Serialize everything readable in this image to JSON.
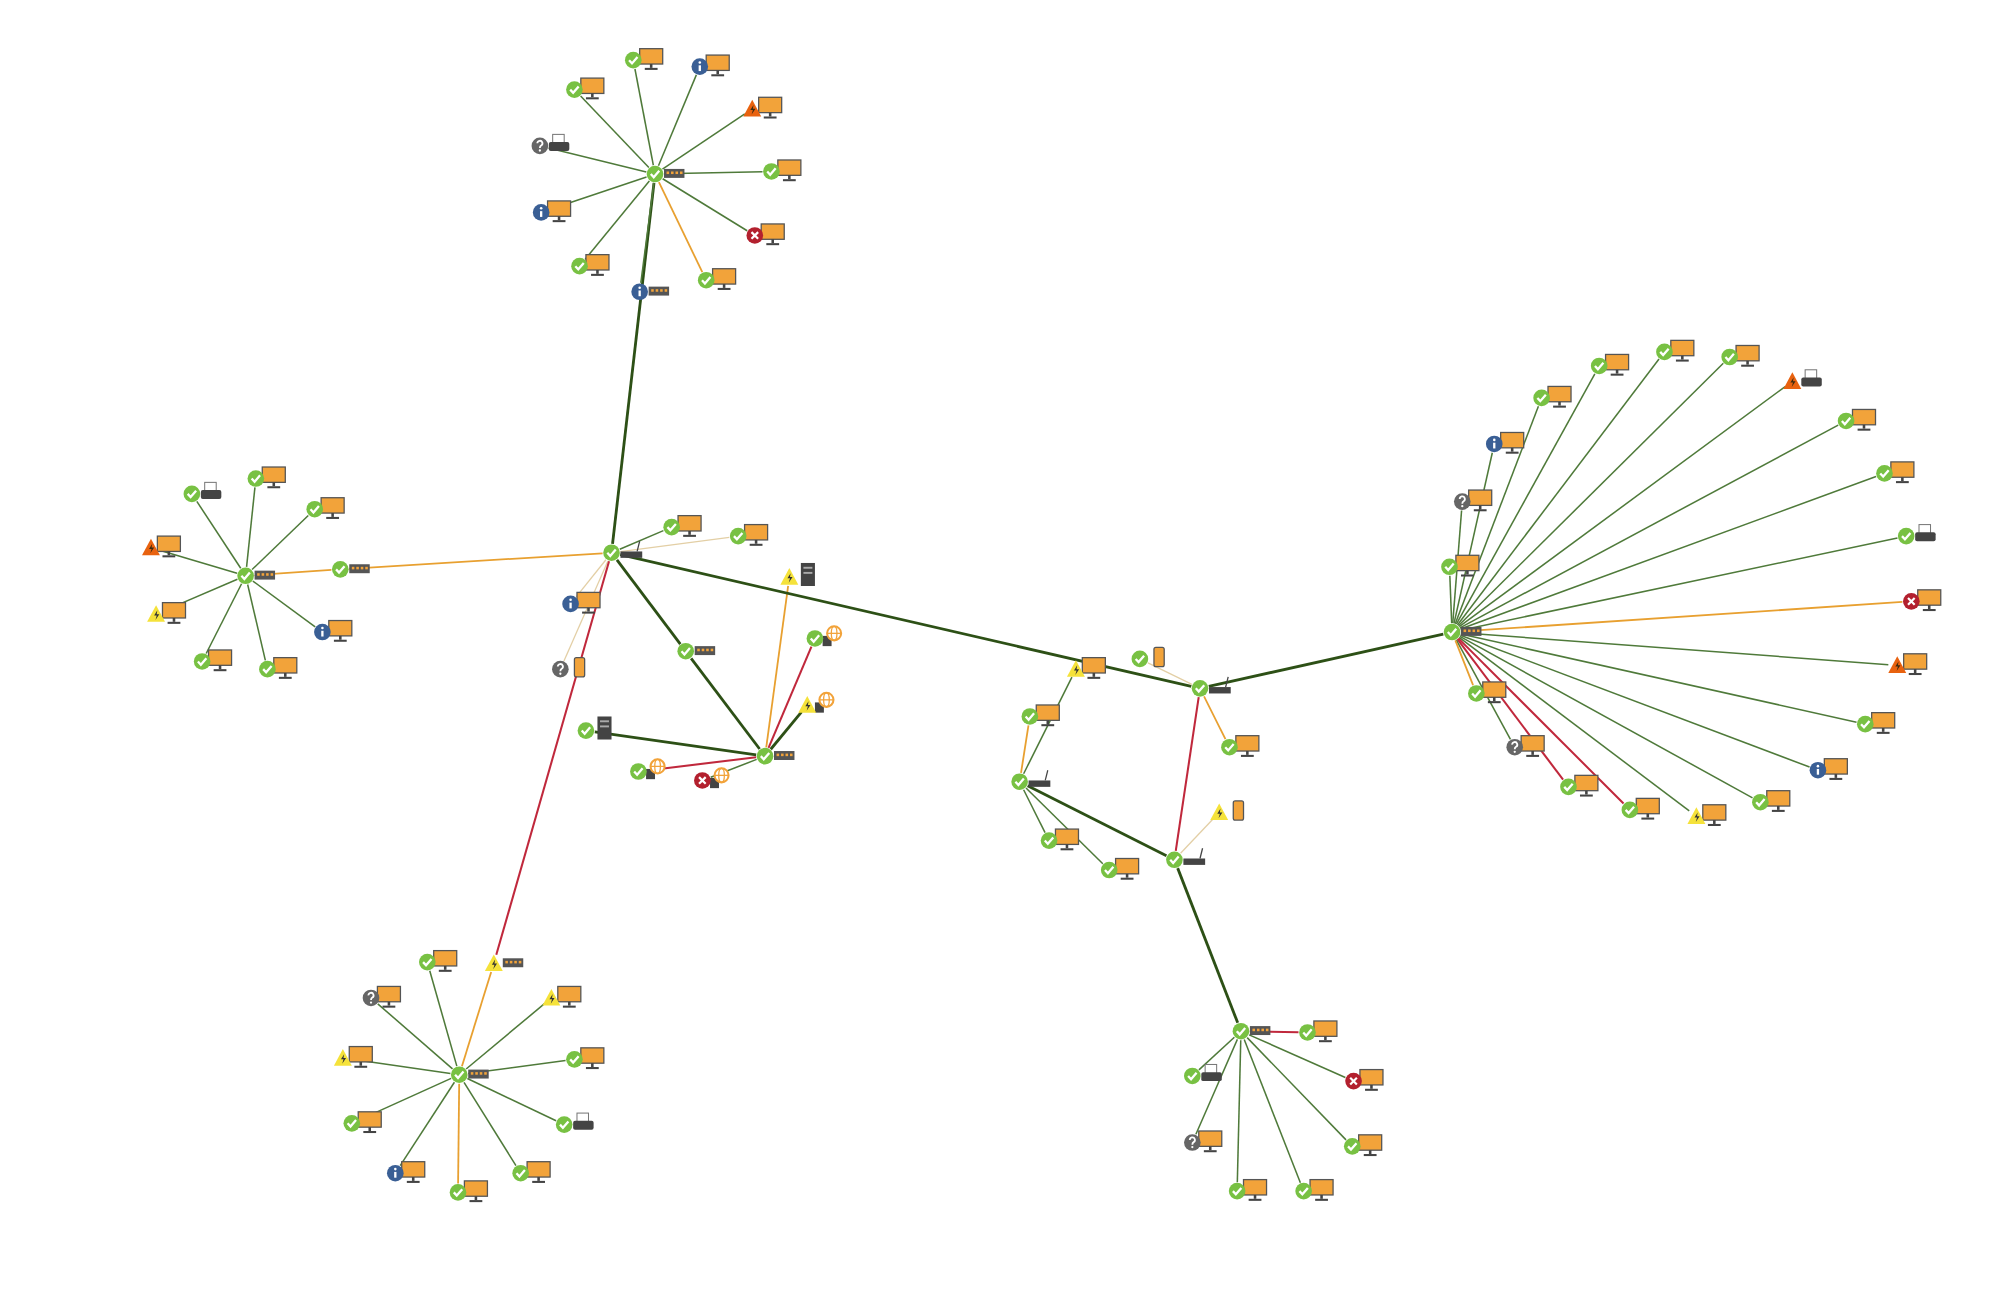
{
  "topology": {
    "kind": "router",
    "badge": {
      "kind": "ok"
    },
    "children": [
      {
        "kind": "switch",
        "badge": {
          "kind": "ok"
        },
        "link": {
          "kind": "strong"
        },
        "children": [
          {
            "kind": "monitor",
            "badge": {
              "kind": "ok"
            },
            "link": {
              "kind": "ok"
            }
          },
          {
            "kind": "monitor",
            "badge": {
              "kind": "info"
            },
            "link": {
              "kind": "ok"
            }
          },
          {
            "kind": "monitor",
            "badge": {
              "kind": "warning"
            },
            "link": {
              "kind": "ok"
            }
          },
          {
            "kind": "monitor",
            "badge": {
              "kind": "ok"
            },
            "link": {
              "kind": "ok"
            }
          },
          {
            "kind": "monitor",
            "badge": {
              "kind": "error"
            },
            "link": {
              "kind": "ok"
            }
          },
          {
            "kind": "monitor",
            "badge": {
              "kind": "ok"
            },
            "link": {
              "kind": "warning"
            }
          },
          {
            "kind": "switch",
            "badge": {
              "kind": "info"
            },
            "link": {
              "kind": "ok"
            }
          },
          {
            "kind": "monitor",
            "badge": {
              "kind": "ok"
            },
            "link": {
              "kind": "ok"
            }
          },
          {
            "kind": "monitor",
            "badge": {
              "kind": "info"
            },
            "link": {
              "kind": "ok"
            }
          },
          {
            "kind": "printer",
            "badge": {
              "kind": "unknown"
            },
            "link": {
              "kind": "ok"
            }
          },
          {
            "kind": "monitor",
            "badge": {
              "kind": "ok"
            },
            "link": {
              "kind": "ok"
            }
          }
        ]
      },
      {
        "kind": "monitor",
        "badge": {
          "kind": "ok"
        },
        "link": {
          "kind": "ok"
        }
      },
      {
        "kind": "monitor",
        "badge": {
          "kind": "ok"
        },
        "link": {
          "kind": "weak"
        }
      },
      {
        "kind": "monitor",
        "badge": {
          "kind": "info"
        },
        "link": {
          "kind": "weak"
        }
      },
      {
        "kind": "phone",
        "badge": {
          "kind": "unknown"
        },
        "link": {
          "kind": "weak"
        }
      },
      {
        "kind": "switch",
        "badge": {
          "kind": "ok"
        },
        "link": {
          "kind": "warning"
        },
        "children": [
          {
            "kind": "switch",
            "badge": {
              "kind": "ok"
            },
            "link": {
              "kind": "warning"
            },
            "children": [
              {
                "kind": "printer",
                "badge": {
                  "kind": "ok"
                },
                "link": {
                  "kind": "ok"
                }
              },
              {
                "kind": "monitor",
                "badge": {
                  "kind": "ok"
                },
                "link": {
                  "kind": "ok"
                }
              },
              {
                "kind": "monitor",
                "badge": {
                  "kind": "ok"
                },
                "link": {
                  "kind": "ok"
                }
              },
              {
                "kind": "monitor",
                "badge": {
                  "kind": "warning"
                },
                "link": {
                  "kind": "ok"
                }
              },
              {
                "kind": "monitor",
                "badge": {
                  "kind": "power"
                },
                "link": {
                  "kind": "ok"
                }
              },
              {
                "kind": "monitor",
                "badge": {
                  "kind": "ok"
                },
                "link": {
                  "kind": "ok"
                }
              },
              {
                "kind": "monitor",
                "badge": {
                  "kind": "ok"
                },
                "link": {
                  "kind": "ok"
                }
              },
              {
                "kind": "monitor",
                "badge": {
                  "kind": "info"
                },
                "link": {
                  "kind": "ok"
                }
              }
            ]
          }
        ]
      },
      {
        "kind": "switch",
        "badge": {
          "kind": "ok"
        },
        "link": {
          "kind": "strong"
        },
        "children": [
          {
            "kind": "switch",
            "badge": {
              "kind": "ok"
            },
            "link": {
              "kind": "strong"
            },
            "children": [
              {
                "kind": "server",
                "badge": {
                  "kind": "power"
                },
                "link": {
                  "kind": "warning"
                }
              },
              {
                "kind": "globe",
                "badge": {
                  "kind": "ok"
                },
                "link": {
                  "kind": "critical"
                }
              },
              {
                "kind": "globe",
                "badge": {
                  "kind": "power"
                },
                "link": {
                  "kind": "strong"
                }
              },
              {
                "kind": "server",
                "badge": {
                  "kind": "ok"
                },
                "link": {
                  "kind": "strong"
                }
              },
              {
                "kind": "globe",
                "badge": {
                  "kind": "ok"
                },
                "link": {
                  "kind": "critical"
                }
              },
              {
                "kind": "globe",
                "badge": {
                  "kind": "error"
                },
                "link": {
                  "kind": "ok"
                }
              }
            ]
          }
        ]
      },
      {
        "kind": "switch",
        "badge": {
          "kind": "power"
        },
        "link": {
          "kind": "critical"
        },
        "children": [
          {
            "kind": "switch",
            "badge": {
              "kind": "ok"
            },
            "link": {
              "kind": "warning"
            },
            "children": [
              {
                "kind": "monitor",
                "badge": {
                  "kind": "ok"
                },
                "link": {
                  "kind": "ok"
                }
              },
              {
                "kind": "monitor",
                "badge": {
                  "kind": "unknown"
                },
                "link": {
                  "kind": "ok"
                }
              },
              {
                "kind": "monitor",
                "badge": {
                  "kind": "power"
                },
                "link": {
                  "kind": "ok"
                }
              },
              {
                "kind": "monitor",
                "badge": {
                  "kind": "power"
                },
                "link": {
                  "kind": "ok"
                }
              },
              {
                "kind": "monitor",
                "badge": {
                  "kind": "ok"
                },
                "link": {
                  "kind": "ok"
                }
              },
              {
                "kind": "monitor",
                "badge": {
                  "kind": "ok"
                },
                "link": {
                  "kind": "ok"
                }
              },
              {
                "kind": "printer",
                "badge": {
                  "kind": "ok"
                },
                "link": {
                  "kind": "ok"
                }
              },
              {
                "kind": "monitor",
                "badge": {
                  "kind": "info"
                },
                "link": {
                  "kind": "ok"
                }
              },
              {
                "kind": "monitor",
                "badge": {
                  "kind": "ok"
                },
                "link": {
                  "kind": "ok"
                }
              },
              {
                "kind": "monitor",
                "badge": {
                  "kind": "ok"
                },
                "link": {
                  "kind": "warning"
                }
              }
            ]
          }
        ]
      },
      {
        "kind": "router",
        "badge": {
          "kind": "ok"
        },
        "link": {
          "kind": "strong"
        },
        "children": [
          {
            "kind": "phone",
            "badge": {
              "kind": "ok"
            },
            "link": {
              "kind": "weak"
            }
          },
          {
            "kind": "monitor",
            "badge": {
              "kind": "ok"
            },
            "link": {
              "kind": "warning"
            }
          },
          {
            "kind": "router",
            "badge": {
              "kind": "ok"
            },
            "link": {
              "kind": "critical"
            },
            "children": [
              {
                "kind": "phone",
                "badge": {
                  "kind": "power"
                },
                "link": {
                  "kind": "weak"
                }
              },
              {
                "kind": "router",
                "badge": {
                  "kind": "ok"
                },
                "link": {
                  "kind": "strong"
                },
                "children": [
                  {
                    "kind": "monitor",
                    "badge": {
                      "kind": "power"
                    },
                    "link": {
                      "kind": "ok"
                    }
                  },
                  {
                    "kind": "monitor",
                    "badge": {
                      "kind": "ok"
                    },
                    "link": {
                      "kind": "warning"
                    }
                  },
                  {
                    "kind": "monitor",
                    "badge": {
                      "kind": "ok"
                    },
                    "link": {
                      "kind": "ok"
                    }
                  },
                  {
                    "kind": "monitor",
                    "badge": {
                      "kind": "ok"
                    },
                    "link": {
                      "kind": "ok"
                    }
                  }
                ]
              },
              {
                "kind": "switch",
                "badge": {
                  "kind": "ok"
                },
                "link": {
                  "kind": "strong"
                },
                "children": [
                  {
                    "kind": "monitor",
                    "badge": {
                      "kind": "ok"
                    },
                    "link": {
                      "kind": "critical"
                    }
                  },
                  {
                    "kind": "printer",
                    "badge": {
                      "kind": "ok"
                    },
                    "link": {
                      "kind": "ok"
                    }
                  },
                  {
                    "kind": "monitor",
                    "badge": {
                      "kind": "error"
                    },
                    "link": {
                      "kind": "ok"
                    }
                  },
                  {
                    "kind": "monitor",
                    "badge": {
                      "kind": "unknown"
                    },
                    "link": {
                      "kind": "ok"
                    }
                  },
                  {
                    "kind": "monitor",
                    "badge": {
                      "kind": "ok"
                    },
                    "link": {
                      "kind": "ok"
                    }
                  },
                  {
                    "kind": "monitor",
                    "badge": {
                      "kind": "ok"
                    },
                    "link": {
                      "kind": "ok"
                    }
                  },
                  {
                    "kind": "monitor",
                    "badge": {
                      "kind": "ok"
                    },
                    "link": {
                      "kind": "ok"
                    }
                  }
                ]
              }
            ]
          },
          {
            "kind": "switch",
            "badge": {
              "kind": "ok"
            },
            "link": {
              "kind": "strong"
            },
            "children": [
              {
                "kind": "monitor",
                "badge": {
                  "kind": "info"
                },
                "link": {
                  "kind": "ok"
                }
              },
              {
                "kind": "monitor",
                "badge": {
                  "kind": "unknown"
                },
                "link": {
                  "kind": "ok"
                }
              },
              {
                "kind": "monitor",
                "badge": {
                  "kind": "ok"
                },
                "link": {
                  "kind": "ok"
                }
              },
              {
                "kind": "monitor",
                "badge": {
                  "kind": "ok"
                },
                "link": {
                  "kind": "ok"
                }
              },
              {
                "kind": "monitor",
                "badge": {
                  "kind": "ok"
                },
                "link": {
                  "kind": "ok"
                }
              },
              {
                "kind": "monitor",
                "badge": {
                  "kind": "ok"
                },
                "link": {
                  "kind": "ok"
                }
              },
              {
                "kind": "monitor",
                "badge": {
                  "kind": "ok"
                },
                "link": {
                  "kind": "ok"
                }
              },
              {
                "kind": "printer",
                "badge": {
                  "kind": "warning"
                },
                "link": {
                  "kind": "ok"
                }
              },
              {
                "kind": "monitor",
                "badge": {
                  "kind": "ok"
                },
                "link": {
                  "kind": "ok"
                }
              },
              {
                "kind": "monitor",
                "badge": {
                  "kind": "ok"
                },
                "link": {
                  "kind": "ok"
                }
              },
              {
                "kind": "printer",
                "badge": {
                  "kind": "ok"
                },
                "link": {
                  "kind": "ok"
                }
              },
              {
                "kind": "monitor",
                "badge": {
                  "kind": "error"
                },
                "link": {
                  "kind": "warning"
                }
              },
              {
                "kind": "monitor",
                "badge": {
                  "kind": "warning"
                },
                "link": {
                  "kind": "ok"
                }
              },
              {
                "kind": "monitor",
                "badge": {
                  "kind": "ok"
                },
                "link": {
                  "kind": "ok"
                }
              },
              {
                "kind": "monitor",
                "badge": {
                  "kind": "info"
                },
                "link": {
                  "kind": "ok"
                }
              },
              {
                "kind": "monitor",
                "badge": {
                  "kind": "ok"
                },
                "link": {
                  "kind": "ok"
                }
              },
              {
                "kind": "monitor",
                "badge": {
                  "kind": "power"
                },
                "link": {
                  "kind": "ok"
                }
              },
              {
                "kind": "monitor",
                "badge": {
                  "kind": "ok"
                },
                "link": {
                  "kind": "critical"
                }
              },
              {
                "kind": "monitor",
                "badge": {
                  "kind": "ok"
                },
                "link": {
                  "kind": "critical"
                }
              },
              {
                "kind": "monitor",
                "badge": {
                  "kind": "unknown"
                },
                "link": {
                  "kind": "ok"
                }
              },
              {
                "kind": "monitor",
                "badge": {
                  "kind": "ok"
                },
                "link": {
                  "kind": "warning"
                }
              }
            ]
          }
        ]
      }
    ]
  }
}
